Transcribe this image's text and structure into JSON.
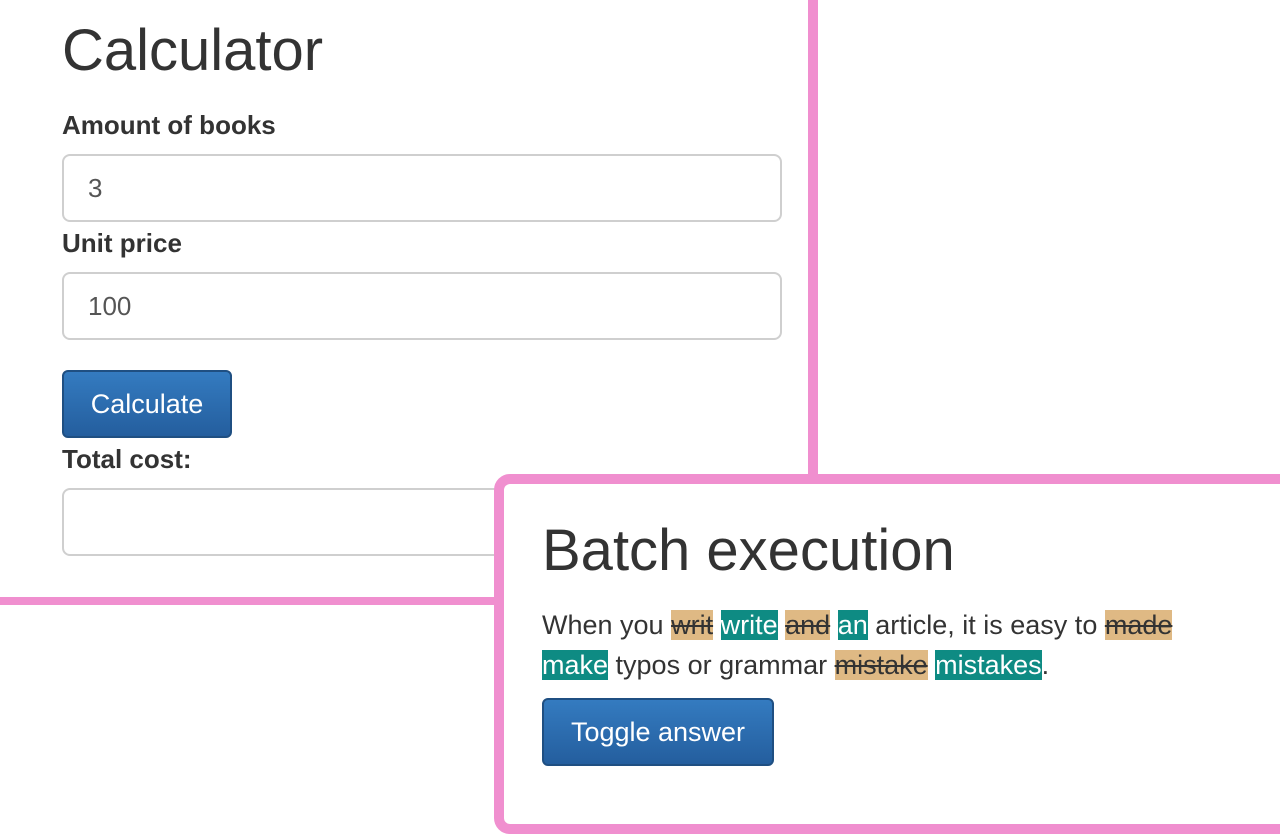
{
  "calculator": {
    "title": "Calculator",
    "amount_label": "Amount of books",
    "amount_value": "3",
    "unit_price_label": "Unit price",
    "unit_price_value": "100",
    "calculate_button": "Calculate",
    "total_label": "Total cost:",
    "total_value": ""
  },
  "batch": {
    "title": "Batch execution",
    "sentence": {
      "t1": "When you ",
      "d1": "writ",
      "s1": " ",
      "i1": "write",
      "s2": " ",
      "d2": "and",
      "s3": " ",
      "i2": "an",
      "t2": " article, it is easy to ",
      "d3": "made",
      "s4": " ",
      "i3": "make",
      "t3": " typos or grammar ",
      "d4": "mistake",
      "s5": " ",
      "i4": "mistakes",
      "t4": "."
    },
    "toggle_button": "Toggle answer"
  },
  "colors": {
    "panel_border": "#f08fcf",
    "button_primary": "#2a6cad",
    "deletion_highlight": "#dfb984",
    "insertion_highlight": "#0e8b83"
  }
}
